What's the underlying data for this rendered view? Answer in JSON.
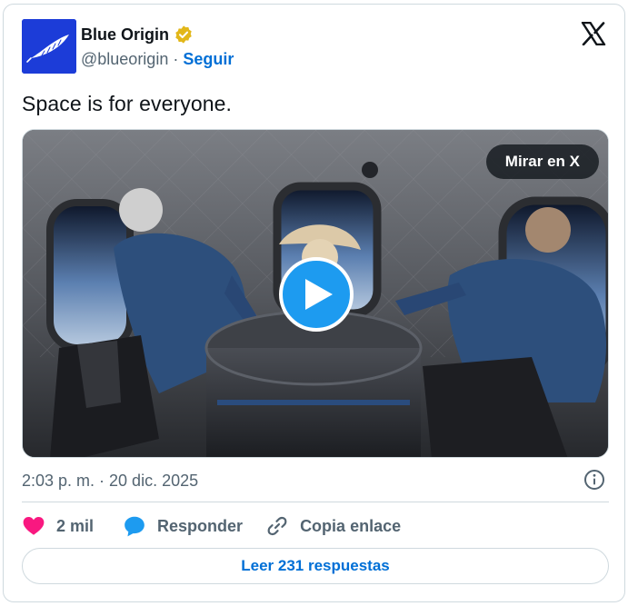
{
  "author": {
    "display_name": "Blue Origin",
    "handle": "@blueorigin",
    "separator": "·",
    "follow_label": "Seguir",
    "brand_color": "#1c3cd8",
    "verified_color": "#e2b719"
  },
  "tweet": {
    "text": "Space is for everyone.",
    "timestamp": "2:03 p. m. · 20 dic. 2025"
  },
  "media": {
    "watch_label": "Mirar en X",
    "play_icon": "play-icon"
  },
  "actions": {
    "like_count": "2 mil",
    "reply_label": "Responder",
    "copy_link_label": "Copia enlace",
    "like_color": "#f91880",
    "reply_color": "#1d9bf0"
  },
  "footer": {
    "read_replies_label": "Leer 231 respuestas"
  },
  "colors": {
    "link": "#006fd6",
    "muted": "#536471",
    "border": "#cfd9de"
  }
}
